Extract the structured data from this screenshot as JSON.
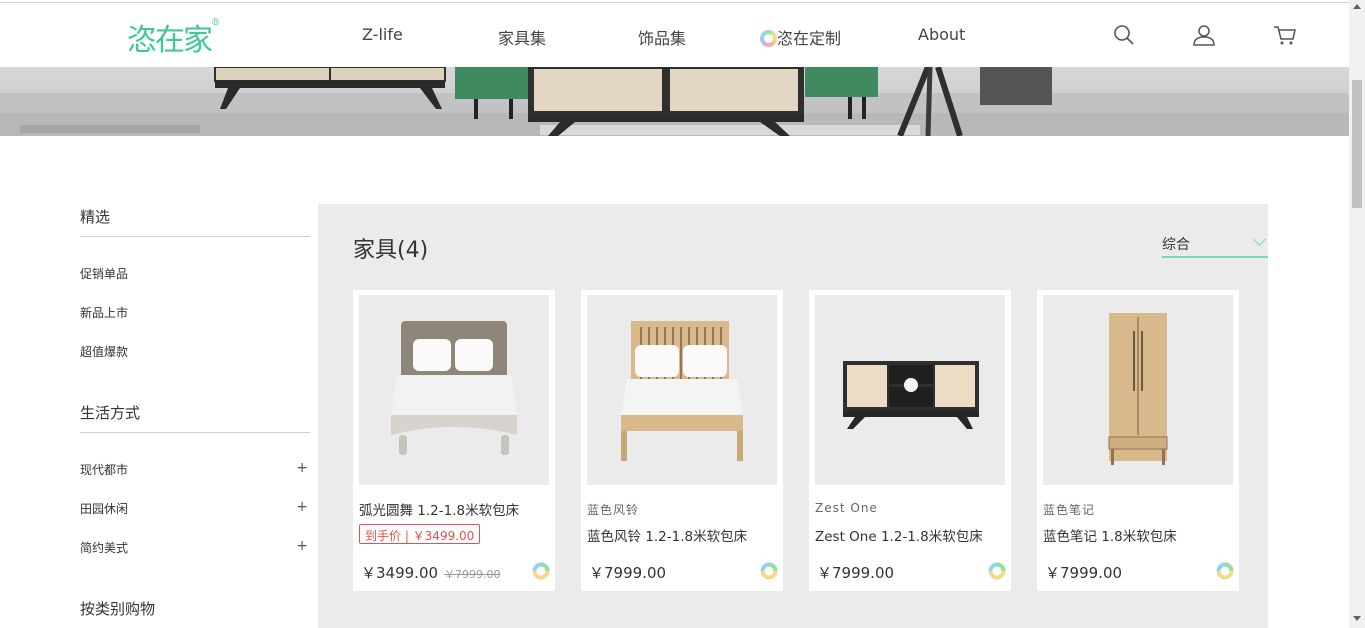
{
  "header": {
    "logo": "恣在家",
    "logo_mark": "®",
    "nav": [
      "Z-life",
      "家具集",
      "饰品集",
      "恣在定制",
      "About"
    ],
    "icons": [
      "search-icon",
      "user-icon",
      "cart-icon"
    ]
  },
  "sidebar": {
    "sections": [
      {
        "title": "精选",
        "items": [
          "促销单品",
          "新品上市",
          "超值爆款"
        ]
      },
      {
        "title": "生活方式",
        "items": [
          "现代都市",
          "田园休闲",
          "简约美式"
        ],
        "expand": "+"
      },
      {
        "title": "按类别购物",
        "items": []
      }
    ]
  },
  "main": {
    "title": "家具(4)",
    "sort_label": "综合",
    "products": [
      {
        "subtitle": "",
        "name": "弧光圆舞 1.2-1.8米软包床",
        "promo": "到手价 | ￥3499.00",
        "price": "￥3499.00",
        "old_price": "￥7999.00"
      },
      {
        "subtitle": "蓝色风铃",
        "name": "蓝色风铃 1.2-1.8米软包床",
        "promo": "",
        "price": "￥7999.00",
        "old_price": ""
      },
      {
        "subtitle": "Zest One",
        "name": "Zest One 1.2-1.8米软包床",
        "promo": "",
        "price": "￥7999.00",
        "old_price": ""
      },
      {
        "subtitle": "蓝色笔记",
        "name": "蓝色笔记 1.8米软包床",
        "promo": "",
        "price": "￥7999.00",
        "old_price": ""
      }
    ]
  },
  "colors": {
    "accent": "#3fc79a",
    "promo": "#e84f4f",
    "panel_bg": "#ebebeb"
  }
}
